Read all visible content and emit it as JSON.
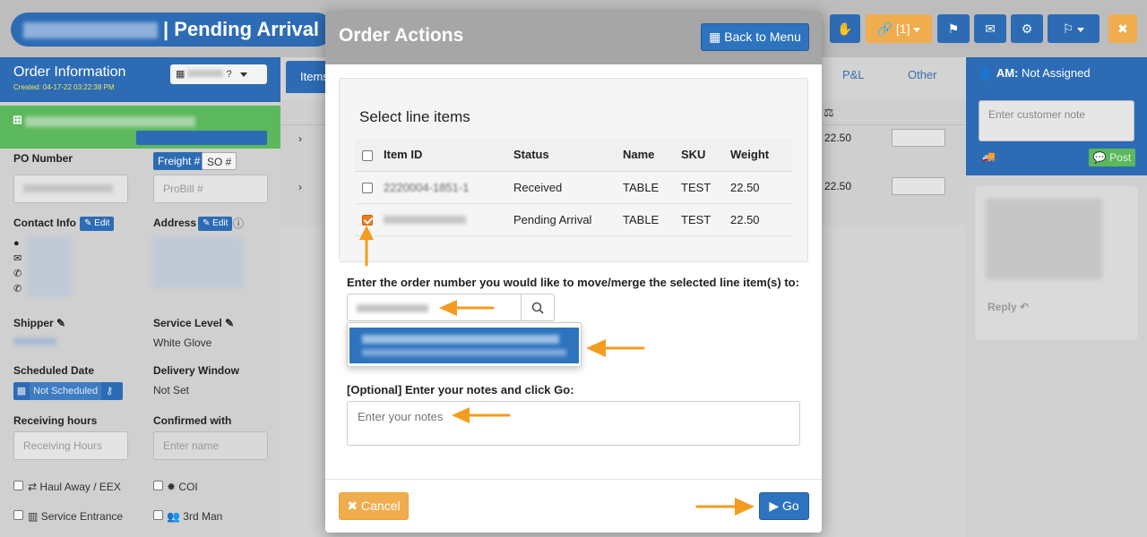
{
  "header": {
    "title_suffix": "| Pending Arrival",
    "link_badge": "[1]"
  },
  "left_panel": {
    "title": "Order Information",
    "created": "Created: 04-17-22 03:22:38 PM",
    "po_number_label": "PO Number",
    "freight_label": "Freight #",
    "so_label": "SO #",
    "probill_placeholder": "ProBill #",
    "contact_label": "Contact Info",
    "address_label": "Address",
    "edit_label": "Edit",
    "shipper_label": "Shipper",
    "service_level_label": "Service Level",
    "service_level_value": "White Glove",
    "scheduled_date_label": "Scheduled Date",
    "not_scheduled": "Not Scheduled",
    "delivery_window_label": "Delivery Window",
    "delivery_window_value": "Not Set",
    "receiving_hours_label": "Receiving hours",
    "receiving_hours_placeholder": "Receiving Hours",
    "confirmed_with_label": "Confirmed with",
    "confirmed_placeholder": "Enter name",
    "haul_away_label": "Haul Away / EEX",
    "coi_label": "COI",
    "service_entrance_label": "Service Entrance",
    "third_man_label": "3rd Man"
  },
  "center": {
    "items_tab": "Items",
    "pnl_tab": "P&L",
    "other_tab": "Other",
    "row_weight_1": "22.50",
    "row_weight_2": "22.50"
  },
  "right_panel": {
    "am_label": "AM:",
    "am_value": "Not Assigned",
    "note_placeholder": "Enter customer note",
    "post_label": "Post",
    "reply_label": "Reply"
  },
  "modal": {
    "title": "Order Actions",
    "back_label": "Back to Menu",
    "panel_title": "Select line items",
    "columns": [
      "Item ID",
      "Status",
      "Name",
      "SKU",
      "Weight"
    ],
    "rows": [
      {
        "item_id": "2220004-1851-1",
        "status": "Received",
        "name": "TABLE",
        "sku": "TEST",
        "weight": "22.50",
        "checked": false
      },
      {
        "item_id": "",
        "status": "Pending Arrival",
        "name": "TABLE",
        "sku": "TEST",
        "weight": "22.50",
        "checked": true
      }
    ],
    "move_label": "Enter the order number you would like to move/merge the selected line item(s) to:",
    "notes_label": "[Optional] Enter your notes and click Go:",
    "notes_placeholder": "Enter your notes",
    "cancel_label": "Cancel",
    "go_label": "Go"
  },
  "colors": {
    "primary": "#2d73bd",
    "warning": "#f0ad4e",
    "success": "#5cb85c",
    "annotation": "#f39c1f"
  }
}
